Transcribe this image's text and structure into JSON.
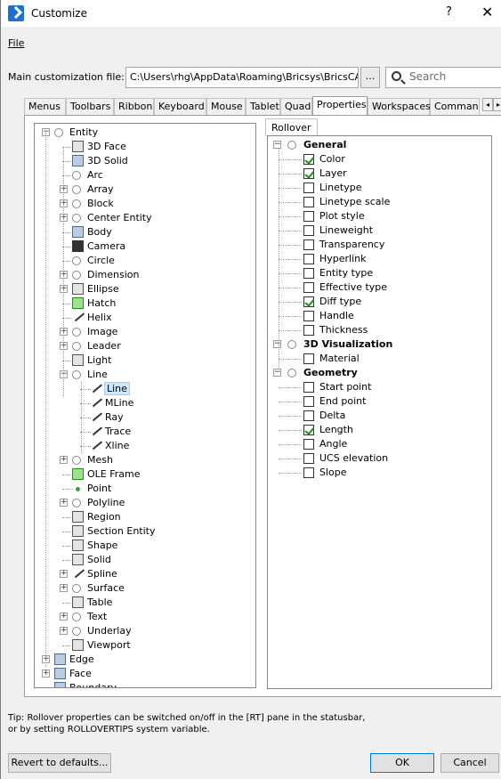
{
  "window": {
    "title": "Customize",
    "help_label": "?",
    "close_label": "✕"
  },
  "menu": {
    "file": "File"
  },
  "path_row": {
    "label": "Main customization file:",
    "value": "C:\\Users\\rhg\\AppData\\Roaming\\Bricsys\\BricsCAD\\",
    "browse_label": "...",
    "search_placeholder": "Search"
  },
  "tabs": [
    "Menus",
    "Toolbars",
    "Ribbon",
    "Keyboard",
    "Mouse",
    "Tablet",
    "Quad",
    "Properties",
    "Workspaces",
    "Comman"
  ],
  "active_tab": "Properties",
  "subtab": "Rollover",
  "tree": [
    {
      "label": "Entity",
      "level": 0,
      "icon": "circle-icon",
      "expander": "−"
    },
    {
      "label": "3D Face",
      "level": 1,
      "icon": "3dface-icon"
    },
    {
      "label": "3D Solid",
      "level": 1,
      "icon": "3dsolid-icon"
    },
    {
      "label": "Arc",
      "level": 1,
      "icon": "arc-icon"
    },
    {
      "label": "Array",
      "level": 1,
      "icon": "circle-icon",
      "expander": "+"
    },
    {
      "label": "Block",
      "level": 1,
      "icon": "circle-icon",
      "expander": "+"
    },
    {
      "label": "Center Entity",
      "level": 1,
      "icon": "circle-icon",
      "expander": "+"
    },
    {
      "label": "Body",
      "level": 1,
      "icon": "body-icon"
    },
    {
      "label": "Camera",
      "level": 1,
      "icon": "camera-icon"
    },
    {
      "label": "Circle",
      "level": 1,
      "icon": "circle-icon"
    },
    {
      "label": "Dimension",
      "level": 1,
      "icon": "circle-icon",
      "expander": "+"
    },
    {
      "label": "Ellipse",
      "level": 1,
      "icon": "ellipse-icon",
      "expander": "+"
    },
    {
      "label": "Hatch",
      "level": 1,
      "icon": "hatch-icon"
    },
    {
      "label": "Helix",
      "level": 1,
      "icon": "helix-icon"
    },
    {
      "label": "Image",
      "level": 1,
      "icon": "circle-icon",
      "expander": "+"
    },
    {
      "label": "Leader",
      "level": 1,
      "icon": "circle-icon",
      "expander": "+"
    },
    {
      "label": "Light",
      "level": 1,
      "icon": "light-icon"
    },
    {
      "label": "Line",
      "level": 1,
      "icon": "circle-icon",
      "expander": "−"
    },
    {
      "label": "Line",
      "level": 2,
      "icon": "line-icon",
      "selected": true
    },
    {
      "label": "MLine",
      "level": 2,
      "icon": "mline-icon"
    },
    {
      "label": "Ray",
      "level": 2,
      "icon": "ray-icon"
    },
    {
      "label": "Trace",
      "level": 2,
      "icon": "trace-icon"
    },
    {
      "label": "Xline",
      "level": 2,
      "icon": "xline-icon"
    },
    {
      "label": "Mesh",
      "level": 1,
      "icon": "circle-icon",
      "expander": "+"
    },
    {
      "label": "OLE Frame",
      "level": 1,
      "icon": "oleframe-icon"
    },
    {
      "label": "Point",
      "level": 1,
      "icon": "point-icon"
    },
    {
      "label": "Polyline",
      "level": 1,
      "icon": "circle-icon",
      "expander": "+"
    },
    {
      "label": "Region",
      "level": 1,
      "icon": "region-icon"
    },
    {
      "label": "Section Entity",
      "level": 1,
      "icon": "section-icon"
    },
    {
      "label": "Shape",
      "level": 1,
      "icon": "shape-icon"
    },
    {
      "label": "Solid",
      "level": 1,
      "icon": "solid-icon"
    },
    {
      "label": "Spline",
      "level": 1,
      "icon": "spline-icon",
      "expander": "+"
    },
    {
      "label": "Surface",
      "level": 1,
      "icon": "circle-icon",
      "expander": "+"
    },
    {
      "label": "Table",
      "level": 1,
      "icon": "table-icon"
    },
    {
      "label": "Text",
      "level": 1,
      "icon": "circle-icon",
      "expander": "+"
    },
    {
      "label": "Underlay",
      "level": 1,
      "icon": "circle-icon",
      "expander": "+"
    },
    {
      "label": "Viewport",
      "level": 1,
      "icon": "viewport-icon"
    },
    {
      "label": "Edge",
      "level": 0,
      "icon": "edge-icon",
      "expander": "+"
    },
    {
      "label": "Face",
      "level": 0,
      "icon": "face-icon",
      "expander": "+"
    },
    {
      "label": "Boundary",
      "level": 0,
      "icon": "boundary-icon"
    }
  ],
  "rollover": [
    {
      "label": "General",
      "group": true
    },
    {
      "label": "Color",
      "checked": true
    },
    {
      "label": "Layer",
      "checked": true
    },
    {
      "label": "Linetype",
      "checked": false
    },
    {
      "label": "Linetype scale",
      "checked": false
    },
    {
      "label": "Plot style",
      "checked": false
    },
    {
      "label": "Lineweight",
      "checked": false
    },
    {
      "label": "Transparency",
      "checked": false
    },
    {
      "label": "Hyperlink",
      "checked": false
    },
    {
      "label": "Entity type",
      "checked": false
    },
    {
      "label": "Effective type",
      "checked": false
    },
    {
      "label": "Diff type",
      "checked": true
    },
    {
      "label": "Handle",
      "checked": false
    },
    {
      "label": "Thickness",
      "checked": false
    },
    {
      "label": "3D Visualization",
      "group": true
    },
    {
      "label": "Material",
      "checked": false
    },
    {
      "label": "Geometry",
      "group": true
    },
    {
      "label": "Start point",
      "checked": false
    },
    {
      "label": "End point",
      "checked": false
    },
    {
      "label": "Delta",
      "checked": false
    },
    {
      "label": "Length",
      "checked": true
    },
    {
      "label": "Angle",
      "checked": false
    },
    {
      "label": "UCS elevation",
      "checked": false
    },
    {
      "label": "Slope",
      "checked": false
    }
  ],
  "tip": {
    "line1": "Tip: Rollover properties can be switched on/off in the [RT] pane in the statusbar,",
    "line2": "or by setting ROLLOVERTIPS system variable."
  },
  "buttons": {
    "revert": "Revert to defaults...",
    "ok": "OK",
    "cancel": "Cancel"
  }
}
